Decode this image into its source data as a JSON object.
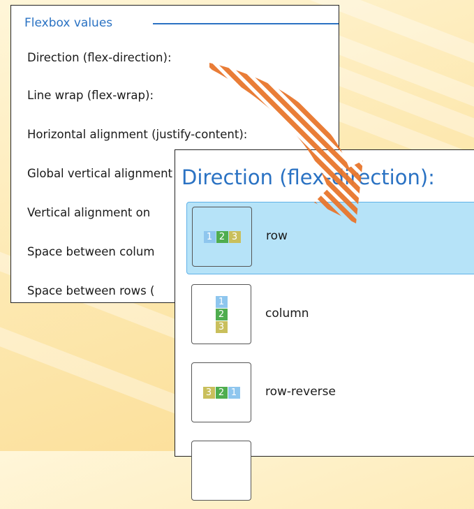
{
  "group_title": "Flexbox values",
  "properties": [
    {
      "label": "Direction (flex-direction):"
    },
    {
      "label": "Line wrap (flex-wrap):"
    },
    {
      "label": "Horizontal alignment (justify-content):"
    },
    {
      "label": "Global vertical alignment"
    },
    {
      "label": "Vertical alignment on"
    },
    {
      "label": "Space between colum"
    },
    {
      "label": "Space between rows ("
    }
  ],
  "popup": {
    "title": "Direction (flex-direction):",
    "options": [
      {
        "label": "row",
        "chips": [
          "1",
          "2",
          "3"
        ],
        "selected": true
      },
      {
        "label": "column",
        "chips": [
          "1",
          "2",
          "3"
        ],
        "selected": false
      },
      {
        "label": "row-reverse",
        "chips": [
          "3",
          "2",
          "1"
        ],
        "selected": false
      }
    ]
  },
  "colors": {
    "accent": "#2a72c3",
    "selection": "#b6e3f8",
    "arrow": "#e8762c",
    "chip_1": "#8ec6ee",
    "chip_2": "#4fad4f",
    "chip_3": "#c9bf5c"
  }
}
